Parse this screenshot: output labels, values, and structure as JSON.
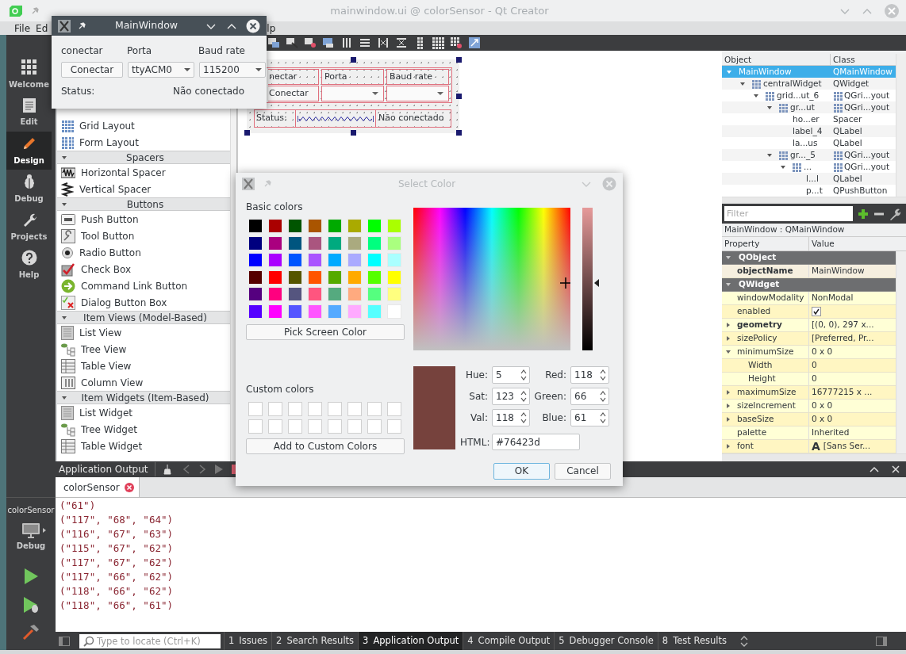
{
  "window": {
    "title": "mainwindow.ui @ colorSensor - Qt Creator"
  },
  "menu": [
    "File",
    "Ed",
    "lp"
  ],
  "modes": [
    {
      "kind": "welcome",
      "label": "Welcome",
      "selected": false
    },
    {
      "kind": "edit",
      "label": "Edit",
      "selected": false
    },
    {
      "kind": "design",
      "label": "Design",
      "selected": true
    },
    {
      "kind": "debug",
      "label": "Debug",
      "selected": false
    },
    {
      "kind": "projects",
      "label": "Projects",
      "selected": false
    },
    {
      "kind": "help",
      "label": "Help",
      "selected": false
    }
  ],
  "run_target": {
    "project": "colorSensor",
    "config": "Debug"
  },
  "widget_box": [
    {
      "kind": "grid",
      "label": "Grid Layout"
    },
    {
      "kind": "form",
      "label": "Form Layout"
    },
    {
      "kind": "category",
      "label": "Spacers",
      "expanded": true
    },
    {
      "kind": "hspacer",
      "label": "Horizontal Spacer"
    },
    {
      "kind": "vspacer",
      "label": "Vertical Spacer"
    },
    {
      "kind": "category",
      "label": "Buttons",
      "expanded": true
    },
    {
      "kind": "push",
      "label": "Push Button"
    },
    {
      "kind": "tool",
      "label": "Tool Button"
    },
    {
      "kind": "radio",
      "label": "Radio Button"
    },
    {
      "kind": "check",
      "label": "Check Box"
    },
    {
      "kind": "command",
      "label": "Command Link Button"
    },
    {
      "kind": "dialog",
      "label": "Dialog Button Box"
    },
    {
      "kind": "category",
      "label": "Item Views (Model-Based)",
      "expanded": true
    },
    {
      "kind": "list",
      "label": "List View"
    },
    {
      "kind": "tree",
      "label": "Tree View"
    },
    {
      "kind": "table",
      "label": "Table View"
    },
    {
      "kind": "column",
      "label": "Column View"
    },
    {
      "kind": "category",
      "label": "Item Widgets (Item-Based)",
      "expanded": true
    },
    {
      "kind": "list",
      "label": "List Widget"
    },
    {
      "kind": "tree",
      "label": "Tree Widget"
    },
    {
      "kind": "table",
      "label": "Table Widget"
    }
  ],
  "form_preview": {
    "labels": [
      "nectar",
      "Porta",
      "Baud rate"
    ],
    "button": "Conectar",
    "status_label": "Status:",
    "status": "Não conectado"
  },
  "object_inspector": {
    "columns": [
      "Object",
      "Class"
    ],
    "tree": [
      {
        "name": "MainWindow",
        "class": "QMainWindow",
        "kind": "widget",
        "expanded": true,
        "selected": true,
        "children": [
          {
            "name": "centralWidget",
            "class": "QWidget",
            "kind": "container",
            "expanded": true,
            "selected": false,
            "children": [
              {
                "name": "grid...ut_6",
                "class": "QGri...yout",
                "kind": "layout",
                "expanded": true,
                "selected": false,
                "children": [
                  {
                    "name": "gr...ut",
                    "class": "QGri...yout",
                    "kind": "layout",
                    "expanded": true,
                    "selected": false,
                    "children": [
                      {
                        "name": "ho...er",
                        "class": "Spacer",
                        "kind": "widget",
                        "selected": false
                      },
                      {
                        "name": "label_4",
                        "class": "QLabel",
                        "kind": "widget",
                        "selected": false
                      },
                      {
                        "name": "la...us",
                        "class": "QLabel",
                        "kind": "widget",
                        "selected": false
                      }
                    ]
                  },
                  {
                    "name": "gr..._5",
                    "class": "QGri...yout",
                    "kind": "layout",
                    "expanded": true,
                    "selected": false,
                    "children": [
                      {
                        "name": "...",
                        "class": "QGri...yout",
                        "kind": "layout",
                        "expanded": true,
                        "selected": false,
                        "children": [
                          {
                            "name": "l...l",
                            "class": "QLabel",
                            "kind": "widget",
                            "selected": false
                          },
                          {
                            "name": "p...t",
                            "class": "QPushButton",
                            "kind": "widget",
                            "selected": false
                          }
                        ]
                      }
                    ]
                  }
                ]
              }
            ]
          }
        ]
      }
    ]
  },
  "property_editor": {
    "filter_placeholder": "Filter",
    "object": "MainWindow : QMainWindow",
    "columns": [
      "Property",
      "Value"
    ],
    "rows": [
      {
        "kind": "group",
        "name": "QObject",
        "expanded": true
      },
      {
        "kind": "text",
        "name": "objectName",
        "value": "MainWindow",
        "modified": true
      },
      {
        "kind": "group",
        "name": "QWidget",
        "expanded": true
      },
      {
        "kind": "text",
        "name": "windowModality",
        "value": "NonModal",
        "modified": false
      },
      {
        "kind": "checkbox",
        "name": "enabled",
        "checked": true,
        "modified": false
      },
      {
        "kind": "text",
        "name": "geometry",
        "value": "[(0, 0), 297 x...",
        "modified": true,
        "expanded": false
      },
      {
        "kind": "text",
        "name": "sizePolicy",
        "value": "[Preferred, Pr...",
        "modified": false,
        "expanded": false
      },
      {
        "kind": "text",
        "name": "minimumSize",
        "value": "0 x 0",
        "modified": false,
        "expanded": true,
        "children": [
          {
            "kind": "text",
            "name": "Width",
            "value": "0",
            "modified": false
          },
          {
            "kind": "text",
            "name": "Height",
            "value": "0",
            "modified": false
          }
        ]
      },
      {
        "kind": "text",
        "name": "maximumSize",
        "value": "16777215 x ...",
        "modified": false,
        "expanded": false
      },
      {
        "kind": "text",
        "name": "sizeIncrement",
        "value": "0 x 0",
        "modified": false,
        "expanded": false
      },
      {
        "kind": "text",
        "name": "baseSize",
        "value": "0 x 0",
        "modified": false,
        "expanded": false
      },
      {
        "kind": "text",
        "name": "palette",
        "value": "Inherited",
        "modified": false
      },
      {
        "kind": "font",
        "name": "font",
        "glyph": "A",
        "value": "[Sans Ser...",
        "modified": false,
        "expanded": false
      }
    ]
  },
  "output": {
    "title": "Application Output",
    "tabs": [
      {
        "label": "colorSensor",
        "selected": true
      }
    ],
    "lines": [
      "(\"61\")",
      "(\"117\", \"68\", \"64\")",
      "(\"116\", \"67\", \"63\")",
      "(\"115\", \"67\", \"62\")",
      "(\"117\", \"67\", \"62\")",
      "(\"117\", \"66\", \"62\")",
      "(\"118\", \"66\", \"62\")",
      "(\"118\", \"66\", \"61\")"
    ]
  },
  "status_bar": {
    "locator_placeholder": "Type to locate (Ctrl+K)",
    "panes": [
      {
        "number": "1",
        "label": "Issues",
        "selected": false
      },
      {
        "number": "2",
        "label": "Search Results",
        "selected": false
      },
      {
        "number": "3",
        "label": "Application Output",
        "selected": true
      },
      {
        "number": "4",
        "label": "Compile Output",
        "selected": false
      },
      {
        "number": "5",
        "label": "Debugger Console",
        "selected": false
      },
      {
        "number": "8",
        "label": "Test Results",
        "selected": false
      }
    ]
  },
  "app_window": {
    "title": "MainWindow",
    "labels": [
      "conectar",
      "Porta",
      "Baud rate"
    ],
    "button": "Conectar",
    "port": "ttyACM0",
    "baud": "115200",
    "status_label": "Status:",
    "status": "Não conectado"
  },
  "color_dialog": {
    "title": "Select Color",
    "basic_label": "Basic colors",
    "basic_colors": [
      [
        {
          "color": "#000000"
        },
        {
          "color": "#aa0000"
        },
        {
          "color": "#005500"
        },
        {
          "color": "#aa5500"
        },
        {
          "color": "#00aa00"
        },
        {
          "color": "#aaaa00"
        },
        {
          "color": "#00ff00"
        },
        {
          "color": "#aaff00"
        }
      ],
      [
        {
          "color": "#00007f"
        },
        {
          "color": "#aa007f"
        },
        {
          "color": "#00557f"
        },
        {
          "color": "#aa557f"
        },
        {
          "color": "#00aa7f"
        },
        {
          "color": "#aaaa7f"
        },
        {
          "color": "#00ff7f"
        },
        {
          "color": "#aaff7f"
        }
      ],
      [
        {
          "color": "#0000ff"
        },
        {
          "color": "#aa00ff"
        },
        {
          "color": "#0055ff"
        },
        {
          "color": "#aa55ff"
        },
        {
          "color": "#00aaff"
        },
        {
          "color": "#aaaaff"
        },
        {
          "color": "#00ffff"
        },
        {
          "color": "#aaffff"
        }
      ],
      [
        {
          "color": "#550000"
        },
        {
          "color": "#ff0000"
        },
        {
          "color": "#555500"
        },
        {
          "color": "#ff5500"
        },
        {
          "color": "#55aa00"
        },
        {
          "color": "#ffaa00"
        },
        {
          "color": "#55ff00"
        },
        {
          "color": "#ffff00"
        }
      ],
      [
        {
          "color": "#55007f"
        },
        {
          "color": "#ff007f"
        },
        {
          "color": "#55557f"
        },
        {
          "color": "#ff557f"
        },
        {
          "color": "#55aa7f"
        },
        {
          "color": "#ffaa7f"
        },
        {
          "color": "#55ff7f"
        },
        {
          "color": "#ffff7f"
        }
      ],
      [
        {
          "color": "#5500ff"
        },
        {
          "color": "#ff00ff"
        },
        {
          "color": "#5555ff"
        },
        {
          "color": "#ff55ff"
        },
        {
          "color": "#55aaff"
        },
        {
          "color": "#ffaaff"
        },
        {
          "color": "#55ffff"
        },
        {
          "color": "#ffffff"
        }
      ]
    ],
    "pick_button": "Pick Screen Color",
    "custom_label": "Custom colors",
    "custom_colors": [
      {
        "color": "#ffffff"
      },
      {
        "color": "#ffffff"
      },
      {
        "color": "#ffffff"
      },
      {
        "color": "#ffffff"
      },
      {
        "color": "#ffffff"
      },
      {
        "color": "#ffffff"
      },
      {
        "color": "#ffffff"
      },
      {
        "color": "#ffffff"
      },
      {
        "color": "#ffffff"
      },
      {
        "color": "#ffffff"
      },
      {
        "color": "#ffffff"
      },
      {
        "color": "#ffffff"
      },
      {
        "color": "#ffffff"
      },
      {
        "color": "#ffffff"
      },
      {
        "color": "#ffffff"
      },
      {
        "color": "#ffffff"
      }
    ],
    "add_button": "Add to Custom Colors",
    "value_slider": {
      "level": 0.47
    },
    "fields": [
      {
        "label": "Hue:",
        "value": "5"
      },
      {
        "label": "Red:",
        "value": "118"
      },
      {
        "label": "Sat:",
        "value": "123"
      },
      {
        "label": "Green:",
        "value": "66"
      },
      {
        "label": "Val:",
        "value": "118"
      },
      {
        "label": "Blue:",
        "value": "61"
      }
    ],
    "html_label": "HTML:",
    "html": "#76423d",
    "buttons": [
      {
        "label": "OK",
        "default": true
      },
      {
        "label": "Cancel",
        "default": false
      }
    ]
  }
}
